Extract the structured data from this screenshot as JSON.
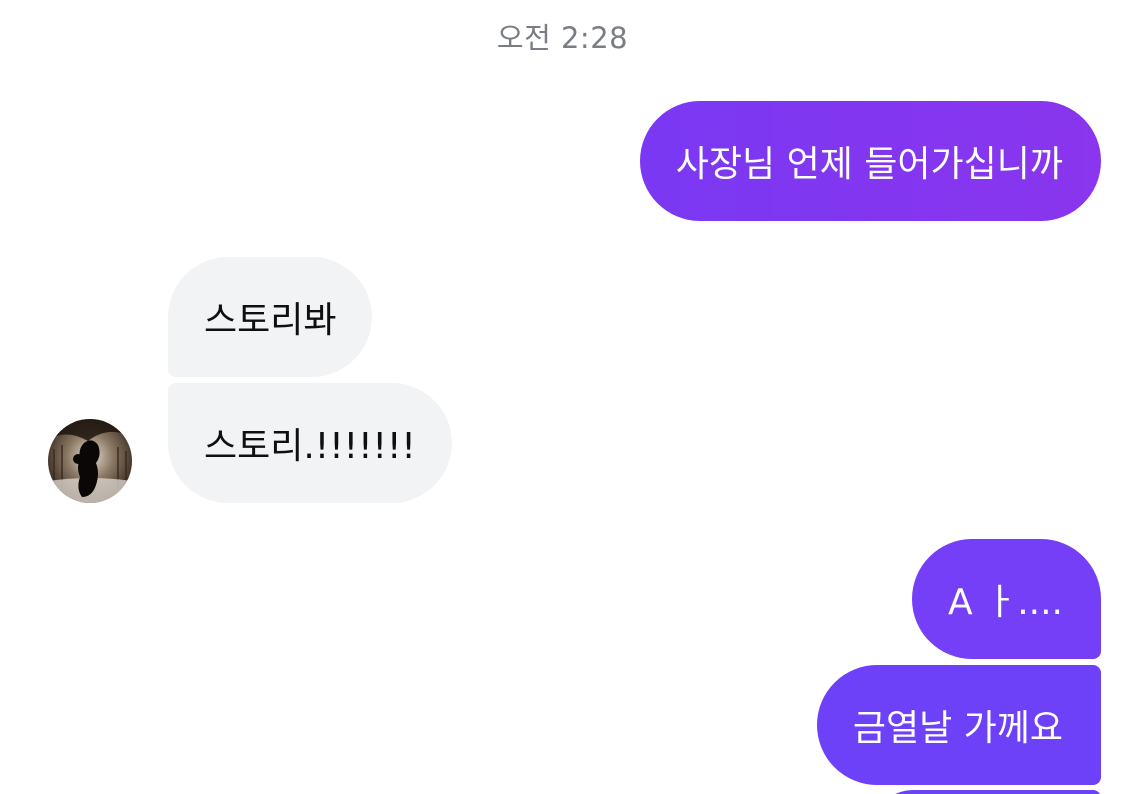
{
  "chat": {
    "timestamp": "오전 2:28",
    "messages": [
      {
        "direction": "outgoing",
        "text": "사장님 언제 들어가십니까"
      },
      {
        "direction": "incoming",
        "text": "스토리봐"
      },
      {
        "direction": "incoming",
        "text": "스토리.!!!!!!!"
      },
      {
        "direction": "outgoing",
        "text": "A ㅏ...."
      },
      {
        "direction": "outgoing",
        "text": "금열날 가께요"
      },
      {
        "direction": "outgoing",
        "text": ""
      }
    ],
    "contact_avatar": {
      "icon": "contact-avatar-photo"
    }
  },
  "colors": {
    "outgoing_bubble_gradient_start": "#7a38f2",
    "outgoing_bubble_gradient_end": "#8a35ee",
    "outgoing_bubble": "#743ff6",
    "incoming_bubble": "#f2f3f5",
    "timestamp_text": "#7a7d84"
  }
}
